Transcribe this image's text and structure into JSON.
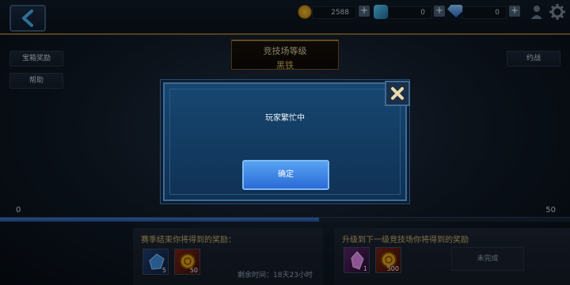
{
  "top_bar": {
    "gold": "2588",
    "ruby": "0",
    "diamond": "0",
    "colors": {
      "gold": "#e3a619",
      "ruby": "#3aa9d8",
      "diamond": "#4e9cf0"
    }
  },
  "left_buttons": [
    {
      "label": "宝箱奖励"
    },
    {
      "label": "帮助"
    }
  ],
  "right_button": {
    "label": "约战"
  },
  "rank": {
    "title": "竞技场等级",
    "level": "黑铁"
  },
  "progress": {
    "min": "0",
    "max": "50",
    "fill_fraction": 0.56
  },
  "season_panel": {
    "title": "赛季结束你将得到的奖励：",
    "rewards": [
      {
        "icon": "gem-pack-icon",
        "count": "5"
      },
      {
        "icon": "gold-coin-icon",
        "count": "50"
      }
    ],
    "time_left": "剩余时间：18天23小时"
  },
  "upgrade_panel": {
    "title": "升级到下一级竞技场你将得到的奖励",
    "rewards": [
      {
        "icon": "crystal-icon",
        "count": "1"
      },
      {
        "icon": "gold-coin-icon",
        "count": "500"
      }
    ],
    "status": "未完成"
  },
  "dialog": {
    "message": "玩家繁忙中",
    "confirm": "确定"
  }
}
